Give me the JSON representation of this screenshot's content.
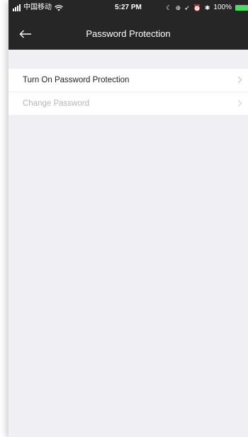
{
  "status_bar": {
    "carrier": "中国移动",
    "time": "5:27 PM",
    "battery": "100%"
  },
  "navbar": {
    "title": "Password Protection"
  },
  "settings_list": [
    {
      "label": "Turn On Password Protection",
      "enabled": true
    },
    {
      "label": "Change Password",
      "enabled": false
    }
  ],
  "colors": {
    "topbar_bg": "#262626",
    "content_bg": "#f0eff4",
    "battery": "#4cd964",
    "disabled_text": "#b5b5b5"
  }
}
